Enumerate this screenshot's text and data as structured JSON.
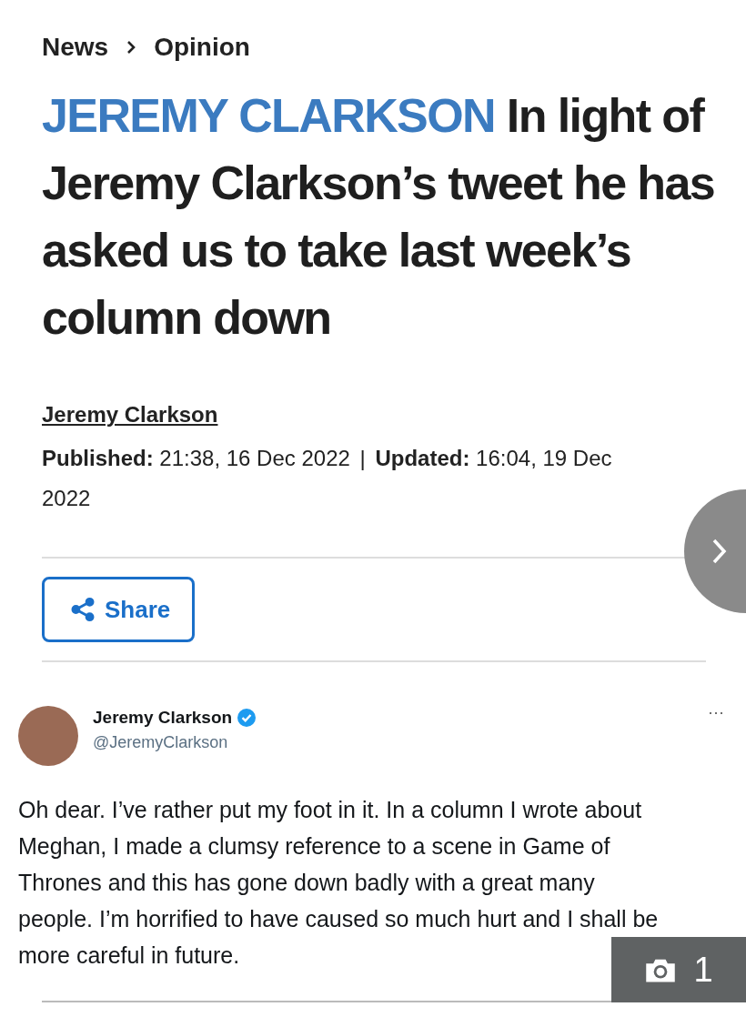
{
  "breadcrumb": [
    {
      "label": "News"
    },
    {
      "label": "Opinion"
    }
  ],
  "headline": {
    "kicker": "JEREMY CLARKSON",
    "title": "In light of Jeremy Clarkson’s tweet he has asked us to take last week’s column down"
  },
  "byline": {
    "author": "Jeremy Clarkson",
    "published_label": "Published:",
    "published": "21:38, 16 Dec 2022",
    "separator": "|",
    "updated_label": "Updated:",
    "updated": "16:04, 19 Dec 2022"
  },
  "share_button": {
    "label": "Share"
  },
  "tweet": {
    "name": "Jeremy Clarkson",
    "verified": true,
    "handle": "@JeremyClarkson",
    "more": "···",
    "text": "Oh dear. I’ve rather put my foot in it. In a column I wrote about Meghan, I made a clumsy reference to a scene in Game of Thrones and this has gone down badly with a great many people. I’m horrified to have caused so much hurt and I shall be more careful in future."
  },
  "gallery_badge": {
    "count": "1"
  }
}
